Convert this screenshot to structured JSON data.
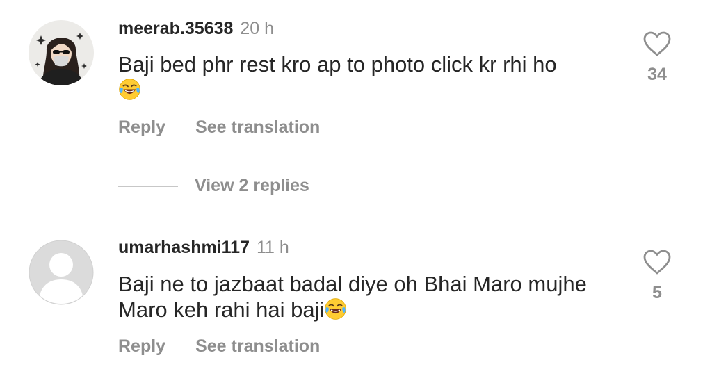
{
  "comments": [
    {
      "username": "meerab.35638",
      "time": "20 h",
      "text": "Baji bed phr rest kro ap to photo click kr rhi ho",
      "emoji": "😂",
      "reply_label": "Reply",
      "translate_label": "See translation",
      "like_count": "34",
      "view_replies_label": "View 2 replies"
    },
    {
      "username": "umarhashmi117",
      "time": "11 h",
      "text": "Baji ne to jazbaat badal diye oh Bhai Maro mujhe Maro keh rahi hai baji",
      "emoji": "😂",
      "reply_label": "Reply",
      "translate_label": "See translation",
      "like_count": "5"
    }
  ],
  "icons": {
    "like": "heart-outline-icon",
    "emoji": "face-with-tears-of-joy-icon",
    "avatar_default": "default-user-silhouette-icon"
  },
  "colors": {
    "text_primary": "#262626",
    "text_secondary": "#8e8e8e",
    "divider": "#c7c7c7",
    "default_avatar_bg": "#dbdbdb"
  }
}
